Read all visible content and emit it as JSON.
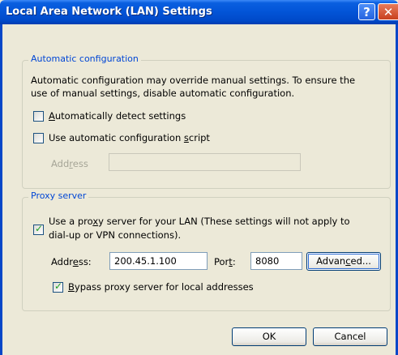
{
  "window": {
    "title": "Local Area Network (LAN) Settings",
    "help_glyph": "?",
    "close_glyph": "✕"
  },
  "auto_config": {
    "legend": "Automatic configuration",
    "description_line1": "Automatic configuration may override manual settings.  To ensure the",
    "description_line2": "use of manual settings, disable automatic configuration.",
    "auto_detect": {
      "label_pre": "",
      "label_u": "A",
      "label_post": "utomatically detect settings",
      "checked": false
    },
    "auto_script": {
      "label_pre": "Use automatic configuration ",
      "label_u": "s",
      "label_post": "cript",
      "checked": false
    },
    "address": {
      "label_pre": "Add",
      "label_u": "r",
      "label_post": "ess",
      "value": ""
    }
  },
  "proxy": {
    "legend": "Proxy server",
    "use_proxy": {
      "line1_pre": "Use a pro",
      "line1_u": "x",
      "line1_post": "y server for your LAN (These settings will not apply to",
      "line2": "dial-up or VPN connections).",
      "checked": true
    },
    "address": {
      "label_pre": "Addr",
      "label_u": "e",
      "label_post": "ss:",
      "value": "200.45.1.100"
    },
    "port": {
      "label_pre": "Por",
      "label_u": "t",
      "label_post": ":",
      "value": "8080"
    },
    "advanced": {
      "label_pre": "Advan",
      "label_u": "c",
      "label_post": "ed..."
    },
    "bypass": {
      "label_pre": "",
      "label_u": "B",
      "label_post": "ypass proxy server for local addresses",
      "checked": true
    }
  },
  "buttons": {
    "ok": "OK",
    "cancel": "Cancel"
  }
}
